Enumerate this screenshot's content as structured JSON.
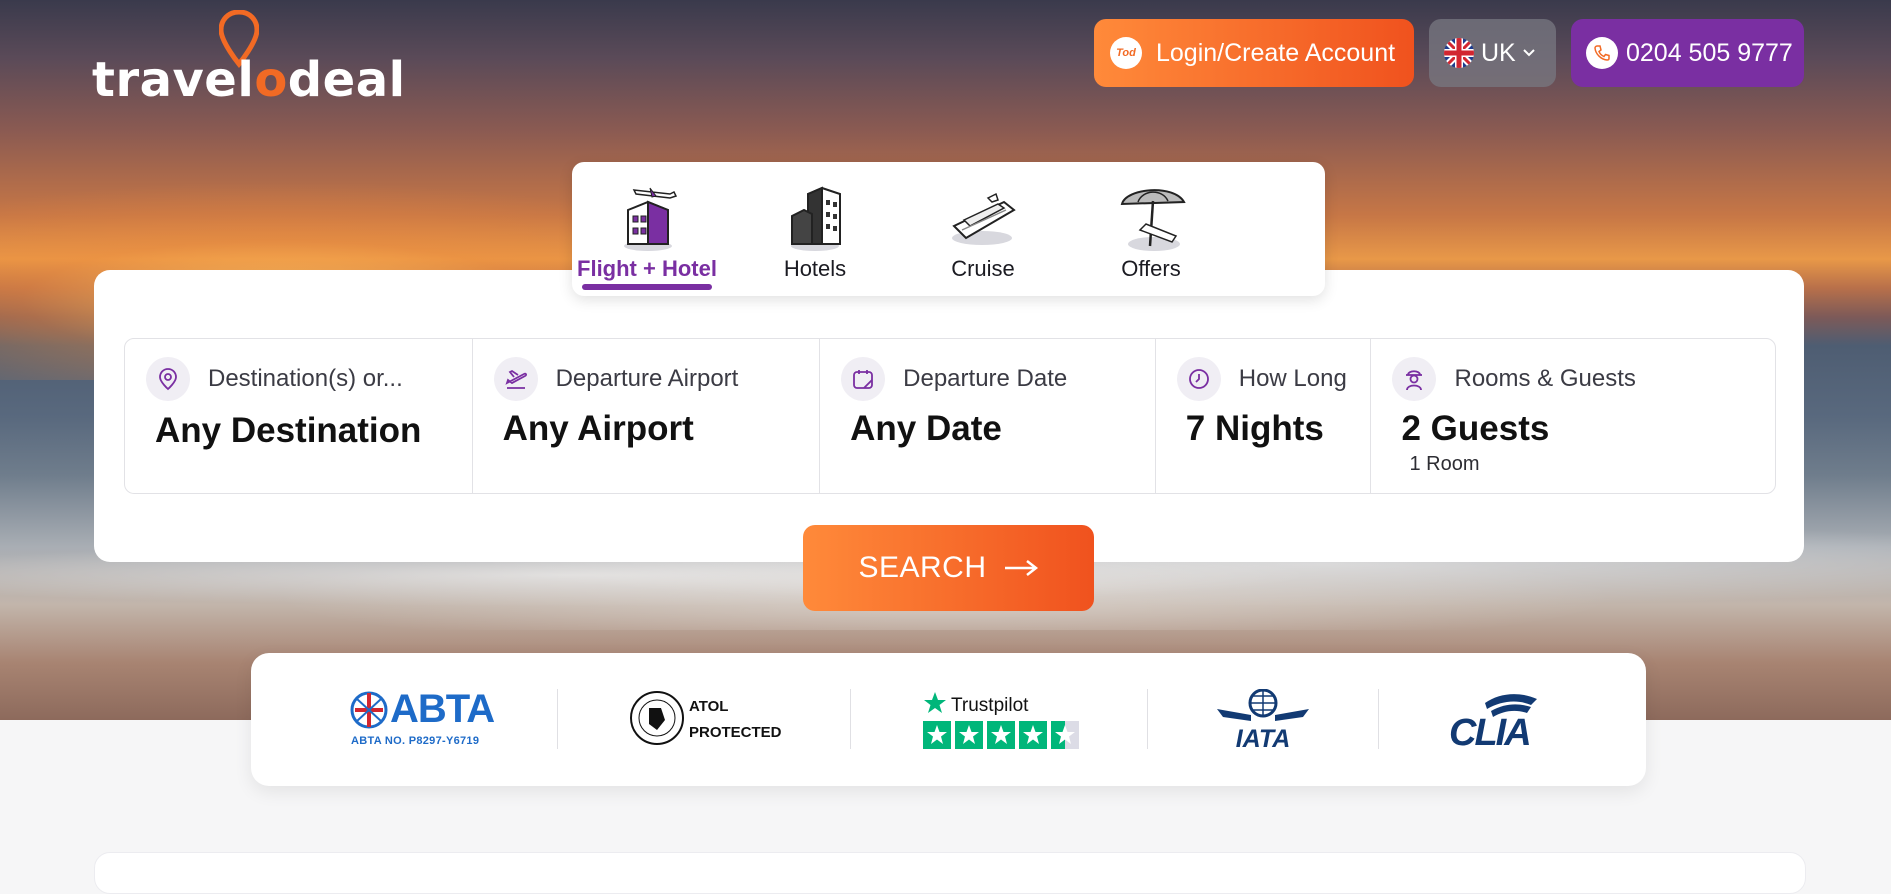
{
  "brand": {
    "logo_text_a": "travel",
    "logo_text_o": "o",
    "logo_text_b": "deal",
    "badge_text": "Tod"
  },
  "header": {
    "login_label": "Login/Create Account",
    "locale_label": "UK",
    "phone_label": "0204 505 9777"
  },
  "tabs": [
    {
      "label": "Flight + Hotel",
      "active": true,
      "icon": "plane-hotel-icon"
    },
    {
      "label": "Hotels",
      "active": false,
      "icon": "buildings-icon"
    },
    {
      "label": "Cruise",
      "active": false,
      "icon": "cruise-ship-icon"
    },
    {
      "label": "Offers",
      "active": false,
      "icon": "beach-umbrella-icon"
    }
  ],
  "search": {
    "fields": [
      {
        "label": "Destination(s) or...",
        "value": "Any Destination",
        "icon": "location-pin-icon"
      },
      {
        "label": "Departure Airport",
        "value": "Any Airport",
        "icon": "plane-departure-icon"
      },
      {
        "label": "Departure Date",
        "value": "Any Date",
        "icon": "calendar-icon"
      },
      {
        "label": "How Long",
        "value": "7 Nights",
        "icon": "clock-icon"
      },
      {
        "label": "Rooms & Guests",
        "value": "2 Guests",
        "sub": "1 Room",
        "icon": "guests-icon"
      }
    ],
    "button_label": "SEARCH"
  },
  "trust": {
    "abta_name": "ABTA",
    "abta_no": "ABTA NO. P8297-Y6719",
    "atol_line1": "ATOL",
    "atol_line2": "PROTECTED",
    "trustpilot_name": "Trustpilot",
    "trustpilot_stars": 4.5,
    "iata_name": "IATA",
    "clia_name": "CLIA"
  },
  "colors": {
    "accent_orange": "#f26a24",
    "brand_purple": "#7a2fa2"
  }
}
